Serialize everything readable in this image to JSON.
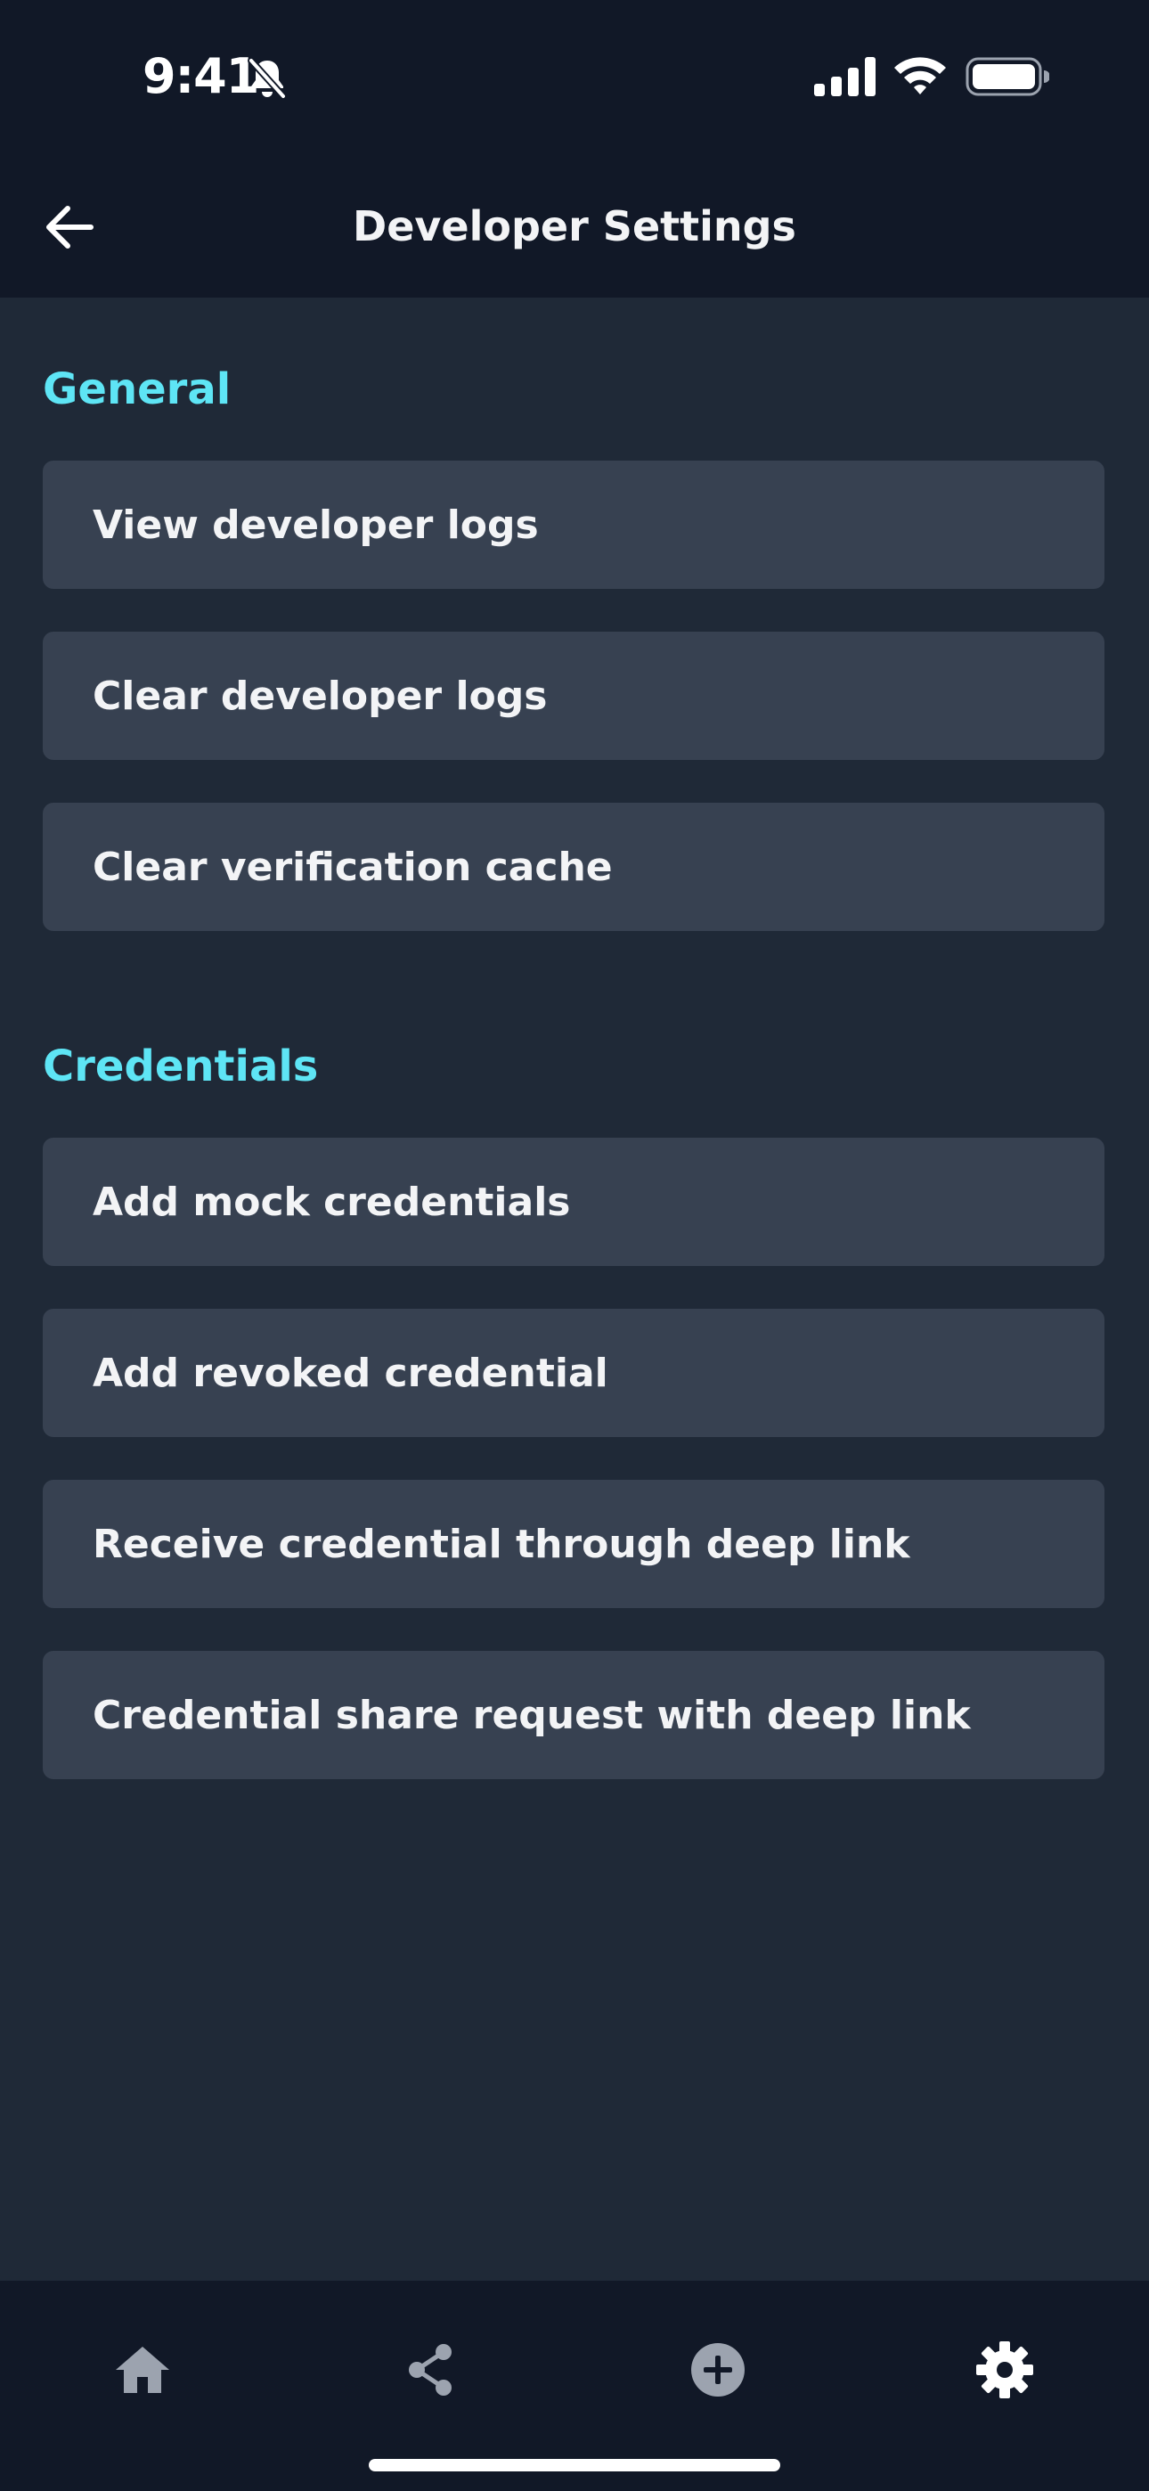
{
  "status_bar": {
    "time": "9:41"
  },
  "header": {
    "title": "Developer Settings"
  },
  "sections": [
    {
      "title": "General",
      "items": [
        {
          "label": "View developer logs"
        },
        {
          "label": "Clear developer logs"
        },
        {
          "label": "Clear verification cache"
        }
      ]
    },
    {
      "title": "Credentials",
      "items": [
        {
          "label": "Add mock credentials"
        },
        {
          "label": "Add revoked credential"
        },
        {
          "label": "Receive credential through deep link"
        },
        {
          "label": "Credential share request with deep link"
        }
      ]
    }
  ],
  "bottom_nav": [
    {
      "icon": "home-icon",
      "active": false
    },
    {
      "icon": "share-icon",
      "active": false
    },
    {
      "icon": "add-circle-icon",
      "active": false
    },
    {
      "icon": "gear-icon",
      "active": true
    }
  ],
  "colors": {
    "background": "#1F2937",
    "header_background": "#111827",
    "row_background": "#374151",
    "section_title": "#5EE5F5",
    "text": "#F3F4F6",
    "nav_inactive": "#9CA3AF",
    "nav_active": "#FFFFFF"
  }
}
